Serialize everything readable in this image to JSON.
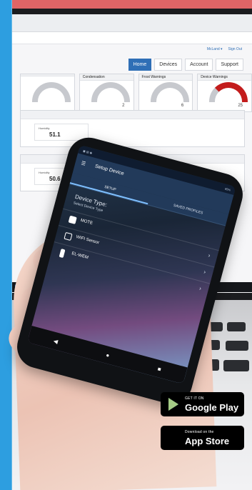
{
  "browser": {
    "title": "",
    "nav": [
      "Home",
      "Devices",
      "Account",
      "Support"
    ],
    "links": [
      "McLand ▾",
      "Sign Out"
    ]
  },
  "dashboard": {
    "cards": [
      {
        "title": "",
        "value": ""
      },
      {
        "title": "Condensation",
        "value": "2"
      },
      {
        "title": "Frost Warnings",
        "value": "6"
      },
      {
        "title": "Device Warnings",
        "value": "25"
      }
    ],
    "readings": [
      {
        "label": "Humidity",
        "value": "51.1"
      },
      {
        "label": "Humidity",
        "value": "50.6"
      }
    ]
  },
  "phone": {
    "title": "Setup Device",
    "tabs": [
      "SETUP",
      "SAVED PROFILES"
    ],
    "section_title": "Device Type:",
    "subtitle": "Select Device Type",
    "options": [
      {
        "label": "MOTE",
        "icon": "mote-icon"
      },
      {
        "label": "WIFI Sensor",
        "icon": "wifi-sensor-icon"
      },
      {
        "label": "EL-WEM",
        "icon": "device-icon"
      }
    ],
    "status_right": "85%"
  },
  "stores": {
    "google": {
      "small": "GET IT ON",
      "big": "Google Play"
    },
    "apple": {
      "small": "Download on the",
      "big": "App Store"
    }
  }
}
